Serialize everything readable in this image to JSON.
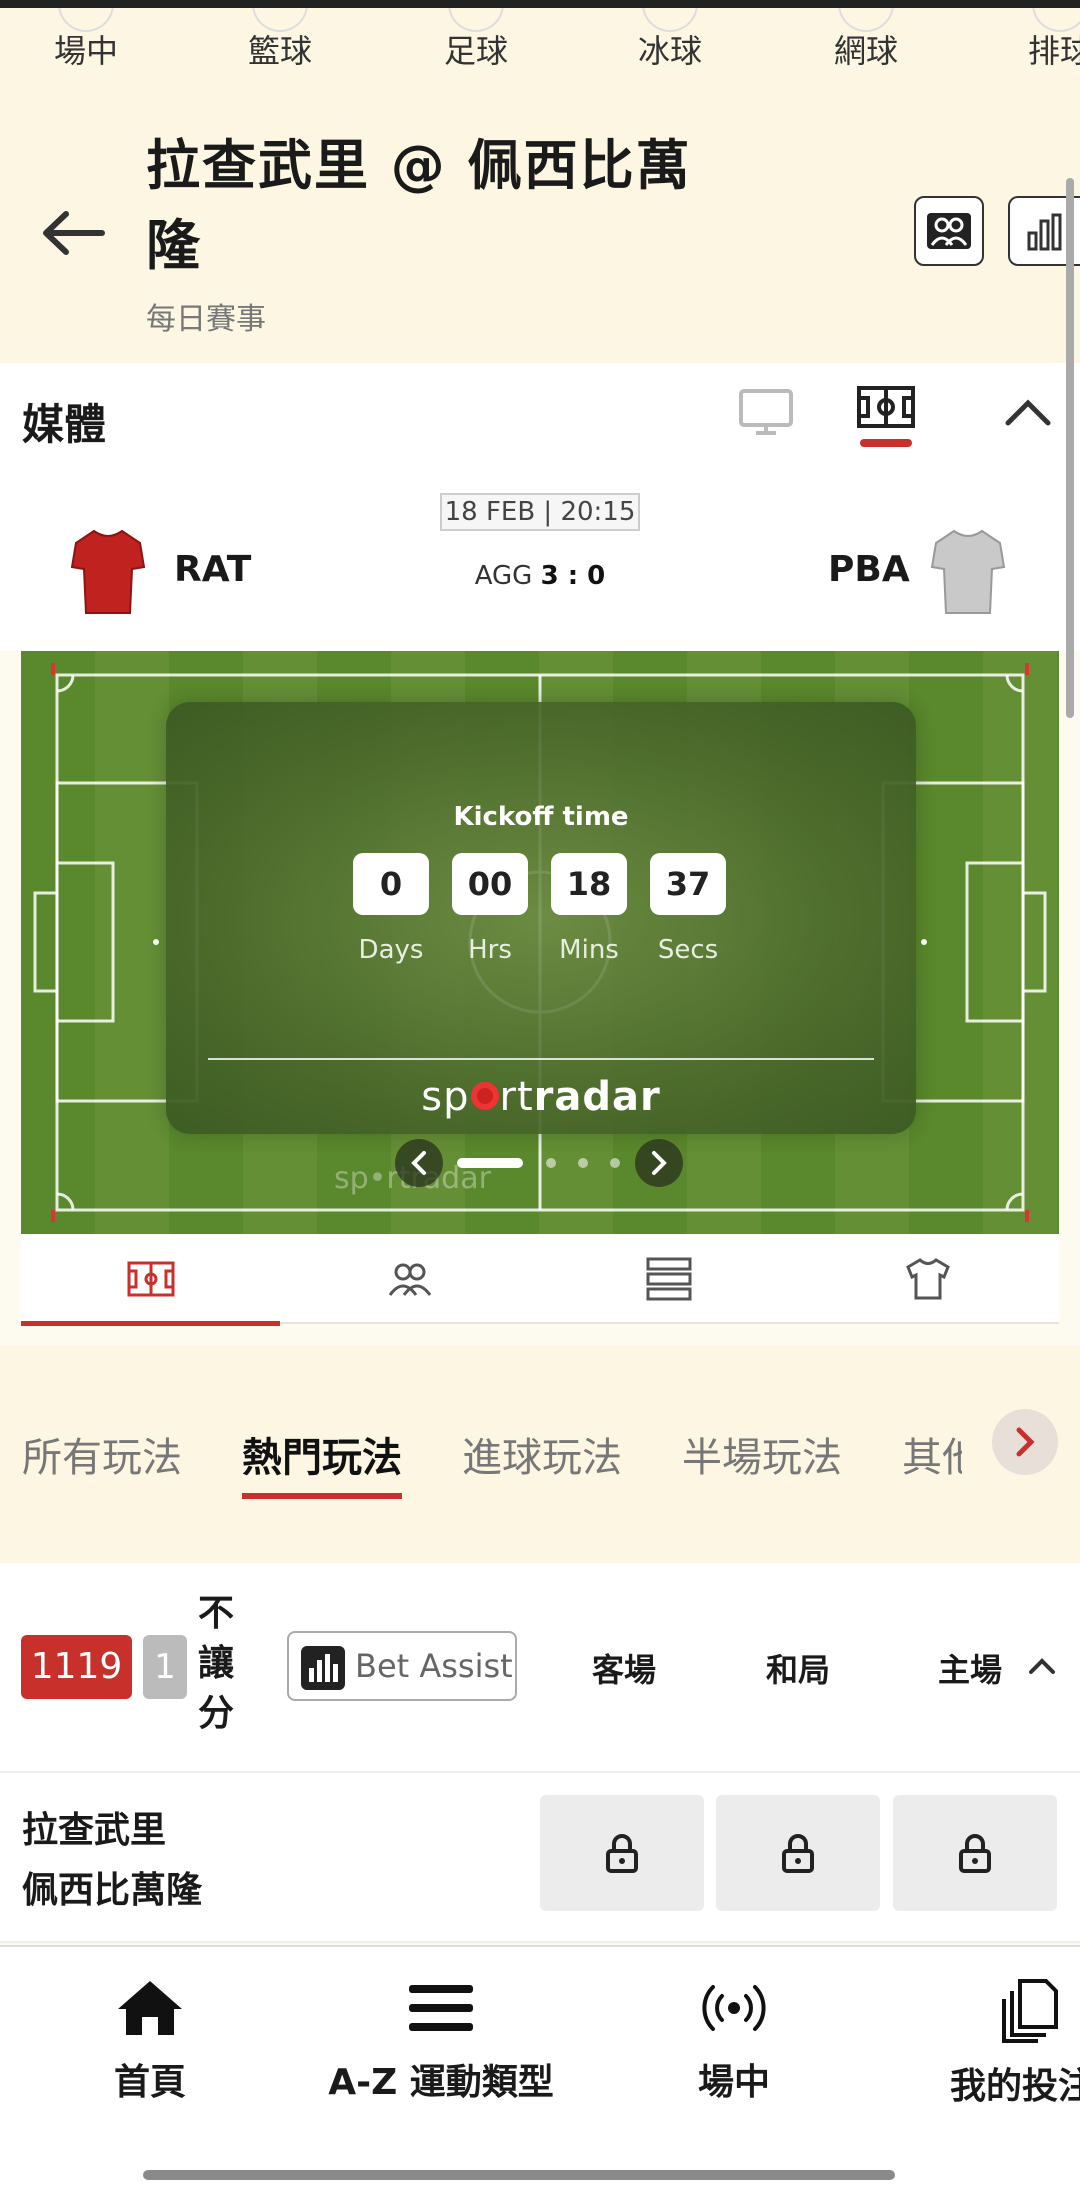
{
  "sport_tabs": [
    "場中",
    "籃球",
    "足球",
    "冰球",
    "網球",
    "排球"
  ],
  "header": {
    "title_line1": "拉查武里 @ 佩西比萬",
    "title_line2": "隆",
    "subtitle": "每日賽事"
  },
  "media": {
    "title": "媒體"
  },
  "match": {
    "datetime": "18 FEB | 20:15",
    "home_abbr": "RAT",
    "away_abbr": "PBA",
    "agg_label": "AGG",
    "agg_score": "3 : 0"
  },
  "countdown": {
    "label": "Kickoff time",
    "days": "0",
    "hours": "00",
    "mins": "18",
    "secs": "37",
    "days_label": "Days",
    "hours_label": "Hrs",
    "mins_label": "Mins",
    "secs_label": "Secs"
  },
  "categories": [
    "所有玩法",
    "熱門玩法",
    "進球玩法",
    "半場玩法",
    "其他"
  ],
  "market": {
    "id": "1119",
    "count": "1",
    "name": "不讓分",
    "bet_assist": "Bet Assist",
    "col_away": "客場",
    "col_draw": "和局",
    "col_home": "主場"
  },
  "odds_row": {
    "team1": "拉查武里",
    "team2": "佩西比萬隆"
  },
  "bottom_nav": {
    "home": "首頁",
    "az": "A-Z 運動類型",
    "live": "場中",
    "mybets": "我的投注"
  },
  "colors": {
    "accent": "#c8302c",
    "cream": "#fcf6e3",
    "pitch": "#5c8a2e"
  }
}
